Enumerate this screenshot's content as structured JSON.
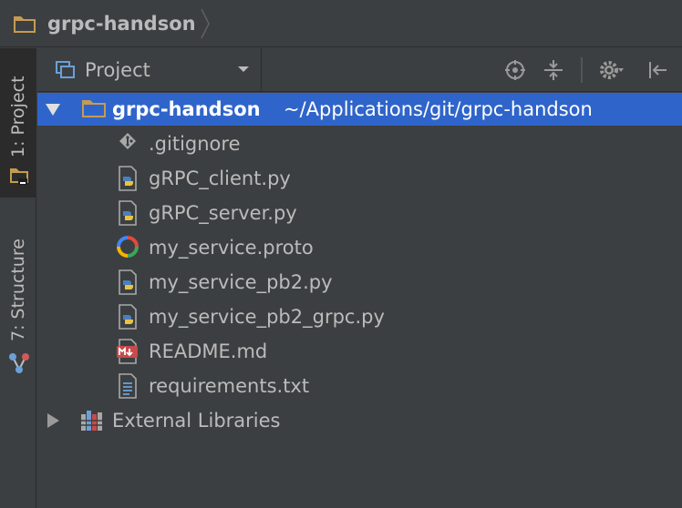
{
  "navbar": {
    "breadcrumb_label": "grpc-handson"
  },
  "toolstrip": {
    "project_tab": "1: Project",
    "structure_tab": "7: Structure"
  },
  "panel": {
    "view_label": "Project"
  },
  "tree": {
    "root": {
      "name": "grpc-handson",
      "path": "~/Applications/git/grpc-handson"
    },
    "files": [
      {
        "name": ".gitignore",
        "icon": "git-icon"
      },
      {
        "name": "gRPC_client.py",
        "icon": "python-file-icon"
      },
      {
        "name": "gRPC_server.py",
        "icon": "python-file-icon"
      },
      {
        "name": "my_service.proto",
        "icon": "proto-file-icon"
      },
      {
        "name": "my_service_pb2.py",
        "icon": "python-file-icon"
      },
      {
        "name": "my_service_pb2_grpc.py",
        "icon": "python-file-icon"
      },
      {
        "name": "README.md",
        "icon": "markdown-file-icon"
      },
      {
        "name": "requirements.txt",
        "icon": "text-file-icon"
      }
    ],
    "external": "External Libraries"
  },
  "colors": {
    "background": "#3c3f41",
    "selection": "#2f65ca",
    "folder": "#c59b52",
    "text": "#bbbbbb"
  }
}
